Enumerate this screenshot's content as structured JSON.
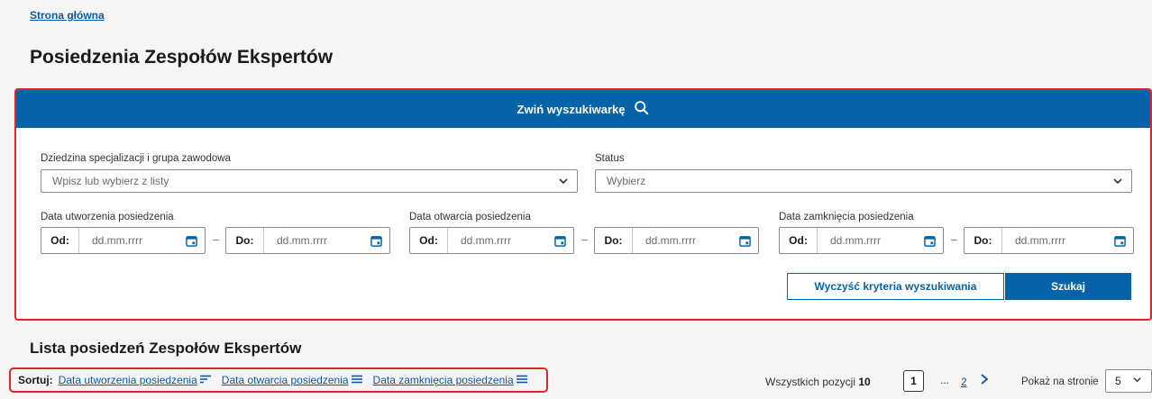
{
  "breadcrumb": "Strona główna",
  "page_title": "Posiedzenia Zespołów Ekspertów",
  "search": {
    "toggle_label": "Zwiń wyszukiwarkę",
    "specialization": {
      "label": "Dziedzina specjalizacji i grupa zawodowa",
      "placeholder": "Wpisz lub wybierz z listy"
    },
    "status": {
      "label": "Status",
      "placeholder": "Wybierz"
    },
    "created": {
      "label": "Data utworzenia posiedzenia",
      "from_prefix": "Od:",
      "to_prefix": "Do:",
      "from_placeholder": "dd.mm.rrrr",
      "to_placeholder": "dd.mm.rrrr"
    },
    "opened": {
      "label": "Data otwarcia posiedzenia",
      "from_prefix": "Od:",
      "to_prefix": "Do:",
      "from_placeholder": "dd.mm.rrrr",
      "to_placeholder": "dd.mm.rrrr"
    },
    "closed": {
      "label": "Data zamknięcia posiedzenia",
      "from_prefix": "Od:",
      "to_prefix": "Do:",
      "from_placeholder": "dd.mm.rrrr",
      "to_placeholder": "dd.mm.rrrr"
    },
    "clear_label": "Wyczyść kryteria wyszukiwania",
    "submit_label": "Szukaj"
  },
  "list": {
    "title": "Lista posiedzeń Zespołów Ekspertów",
    "sort_label": "Sortuj:",
    "sort_options": [
      "Data utworzenia posiedzenia",
      "Data otwarcia posiedzenia",
      "Data zamknięcia posiedzenia"
    ],
    "total_label": "Wszystkich pozycji",
    "total_count": "10",
    "current_page": "1",
    "ellipsis": "...",
    "next_page": "2",
    "per_page_label": "Pokaż na stronie",
    "per_page_value": "5"
  },
  "colors": {
    "primary": "#0763a8",
    "highlight": "#e2252b",
    "link": "#0b58a8"
  }
}
